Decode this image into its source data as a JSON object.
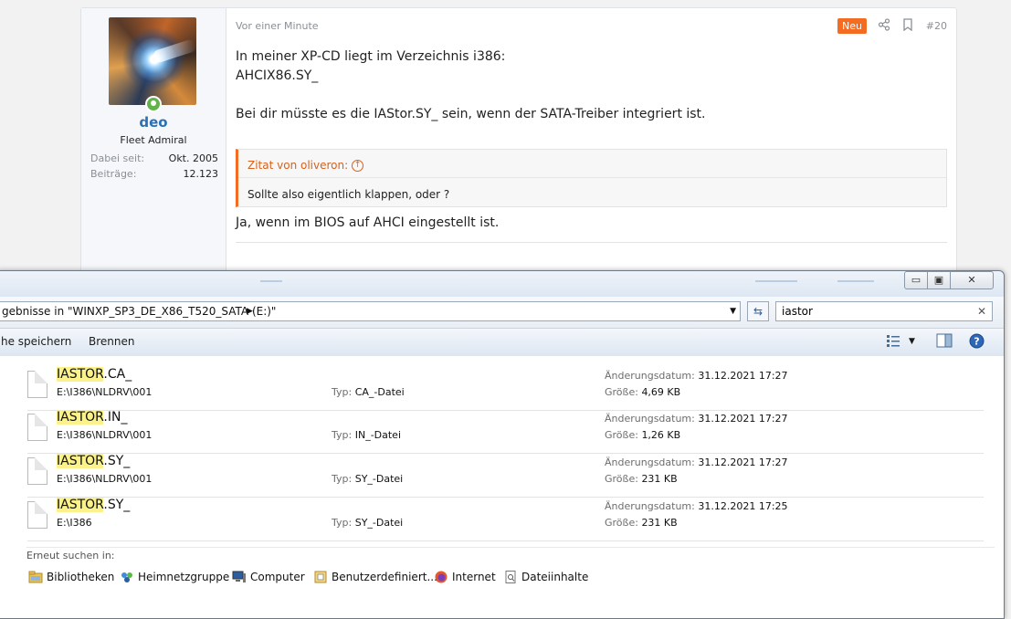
{
  "post": {
    "user": {
      "name": "deo",
      "title": "Fleet Admiral",
      "joined_label": "Dabei seit:",
      "joined_value": "Okt. 2005",
      "posts_label": "Beiträge:",
      "posts_value": "12.123"
    },
    "time": "Vor einer Minute",
    "badge": "Neu",
    "number": "#20",
    "lines": [
      "In meiner XP-CD liegt im Verzeichnis i386:",
      "AHCIX86.SY_",
      "Bei dir müsste es die IAStor.SY_ sein, wenn der SATA-Treiber integriert ist."
    ],
    "quote": {
      "author": "Zitat von oliveron:",
      "text": "Sollte also eigentlich klappen, oder ?"
    },
    "reply": "Ja, wenn im BIOS auf AHCI eingestellt ist."
  },
  "explorer": {
    "address": "gebnisse in \"WINXP_SP3_DE_X86_T520_SATA (E:)\"",
    "search_value": "iastor",
    "toolbar": {
      "save": "he speichern",
      "burn": "Brennen"
    },
    "results": [
      {
        "highlight": "IASTOR",
        "rest": ".CA_",
        "path": "E:\\I386\\NLDRV\\001",
        "type_label": "Typ:",
        "type": "CA_-Datei",
        "date_label": "Änderungsdatum:",
        "date": "31.12.2021 17:27",
        "size_label": "Größe:",
        "size": "4,69 KB"
      },
      {
        "highlight": "IASTOR",
        "rest": ".IN_",
        "path": "E:\\I386\\NLDRV\\001",
        "type_label": "Typ:",
        "type": "IN_-Datei",
        "date_label": "Änderungsdatum:",
        "date": "31.12.2021 17:27",
        "size_label": "Größe:",
        "size": "1,26 KB"
      },
      {
        "highlight": "IASTOR",
        "rest": ".SY_",
        "path": "E:\\I386\\NLDRV\\001",
        "type_label": "Typ:",
        "type": "SY_-Datei",
        "date_label": "Änderungsdatum:",
        "date": "31.12.2021 17:27",
        "size_label": "Größe:",
        "size": "231 KB"
      },
      {
        "highlight": "IASTOR",
        "rest": ".SY_",
        "path": "E:\\I386",
        "type_label": "Typ:",
        "type": "SY_-Datei",
        "date_label": "Änderungsdatum:",
        "date": "31.12.2021 17:25",
        "size_label": "Größe:",
        "size": "231 KB"
      }
    ],
    "search_again_label": "Erneut suchen in:",
    "locations": [
      "Bibliotheken",
      "Heimnetzgruppe",
      "Computer",
      "Benutzerdefiniert...",
      "Internet",
      "Dateiinhalte"
    ]
  }
}
